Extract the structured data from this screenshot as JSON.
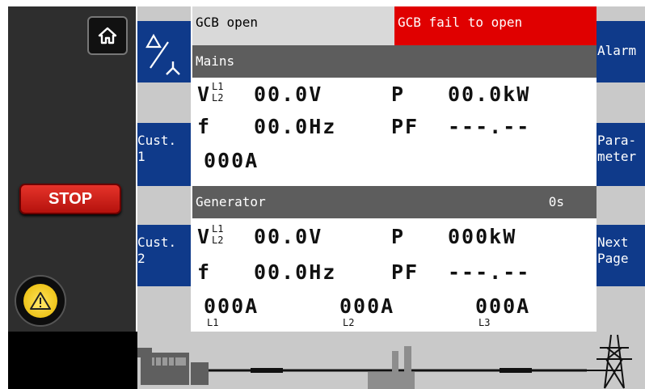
{
  "left_bezel": {
    "home_icon": "home-icon",
    "stop_label": "STOP",
    "warning_icon": "warning-icon"
  },
  "left_buttons": {
    "phase_icon": "delta-star-icon",
    "cust1": [
      "Cust.",
      "1"
    ],
    "cust2": [
      "Cust.",
      "2"
    ]
  },
  "right_buttons": {
    "alarm": "Alarm",
    "parameter": [
      "Para-",
      "meter"
    ],
    "next_page": [
      "Next",
      "Page"
    ]
  },
  "status": {
    "gcb_open": "GCB open",
    "gcb_fail": "GCB fail to open"
  },
  "mains": {
    "title": "Mains",
    "v_label": "V",
    "v_sub_top": "L1",
    "v_sub_bot": "L2",
    "voltage": "00.0V",
    "p_label": "P",
    "power": "00.0kW",
    "f_label": "f",
    "frequency": "00.0Hz",
    "pf_label": "PF",
    "pf": "---.--",
    "current": "000A"
  },
  "generator": {
    "title": "Generator",
    "timer": "0s",
    "v_label": "V",
    "v_sub_top": "L1",
    "v_sub_bot": "L2",
    "voltage": "00.0V",
    "p_label": "P",
    "power": "000kW",
    "f_label": "f",
    "frequency": "00.0Hz",
    "pf_label": "PF",
    "pf": "---.--",
    "currents": [
      {
        "value": "000A",
        "phase": "L1"
      },
      {
        "value": "000A",
        "phase": "L2"
      },
      {
        "value": "000A",
        "phase": "L3"
      }
    ]
  },
  "colors": {
    "navy": "#0f3a8a",
    "alarm_red": "#e00000",
    "header_gray": "#5d5d5d"
  },
  "diagram_icons": [
    "generator-icon",
    "busbar-line",
    "factory-load-icon",
    "transmission-tower-icon"
  ]
}
